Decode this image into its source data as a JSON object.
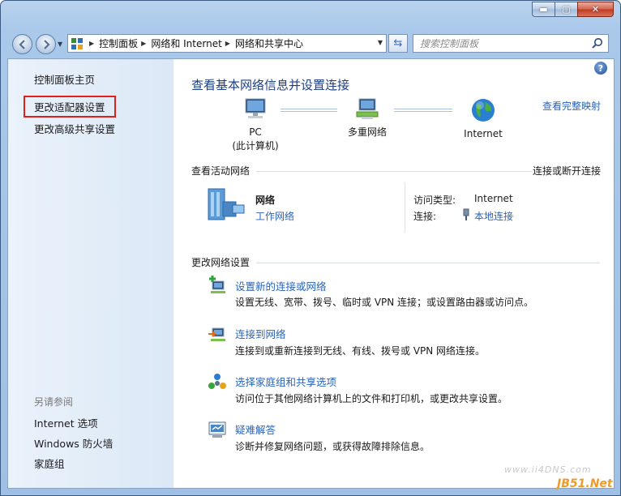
{
  "window": {
    "minimize_glyph": "▬",
    "maximize_glyph": "▢",
    "close_glyph": "✕"
  },
  "nav": {
    "back_icon": "back-arrow",
    "forward_icon": "forward-arrow",
    "breadcrumbs": [
      "控制面板",
      "网络和 Internet",
      "网络和共享中心"
    ],
    "search_placeholder": "搜索控制面板"
  },
  "sidebar": {
    "items": [
      {
        "label": "控制面板主页"
      },
      {
        "label": "更改适配器设置"
      },
      {
        "label": "更改高级共享设置"
      }
    ],
    "see_also": {
      "heading": "另请参阅",
      "items": [
        {
          "label": "Internet 选项"
        },
        {
          "label": "Windows 防火墙"
        },
        {
          "label": "家庭组"
        }
      ]
    }
  },
  "main": {
    "help": "?",
    "title": "查看基本网络信息并设置连接",
    "full_map_link": "查看完整映射",
    "network_map": {
      "pc_label": "PC",
      "pc_sub": "(此计算机)",
      "middle_label": "多重网络",
      "internet_label": "Internet"
    },
    "active_networks": {
      "heading": "查看活动网络",
      "connect_link": "连接或断开连接",
      "network_name": "网络",
      "network_type_link": "工作网络",
      "access_type_label": "访问类型:",
      "access_type_value": "Internet",
      "connections_label": "连接:",
      "connections_value": "本地连接"
    },
    "change_settings": {
      "heading": "更改网络设置",
      "tasks": [
        {
          "title": "设置新的连接或网络",
          "desc": "设置无线、宽带、拨号、临时或 VPN 连接；或设置路由器或访问点。"
        },
        {
          "title": "连接到网络",
          "desc": "连接到或重新连接到无线、有线、拨号或 VPN 网络连接。"
        },
        {
          "title": "选择家庭组和共享选项",
          "desc": "访问位于其他网络计算机上的文件和打印机，或更改共享设置。"
        },
        {
          "title": "疑难解答",
          "desc": "诊断并修复网络问题，或获得故障排除信息。"
        }
      ]
    }
  },
  "watermarks": {
    "site": "www.ii4DNS.com",
    "brand_a": "JB51",
    "brand_b": ".Net"
  }
}
